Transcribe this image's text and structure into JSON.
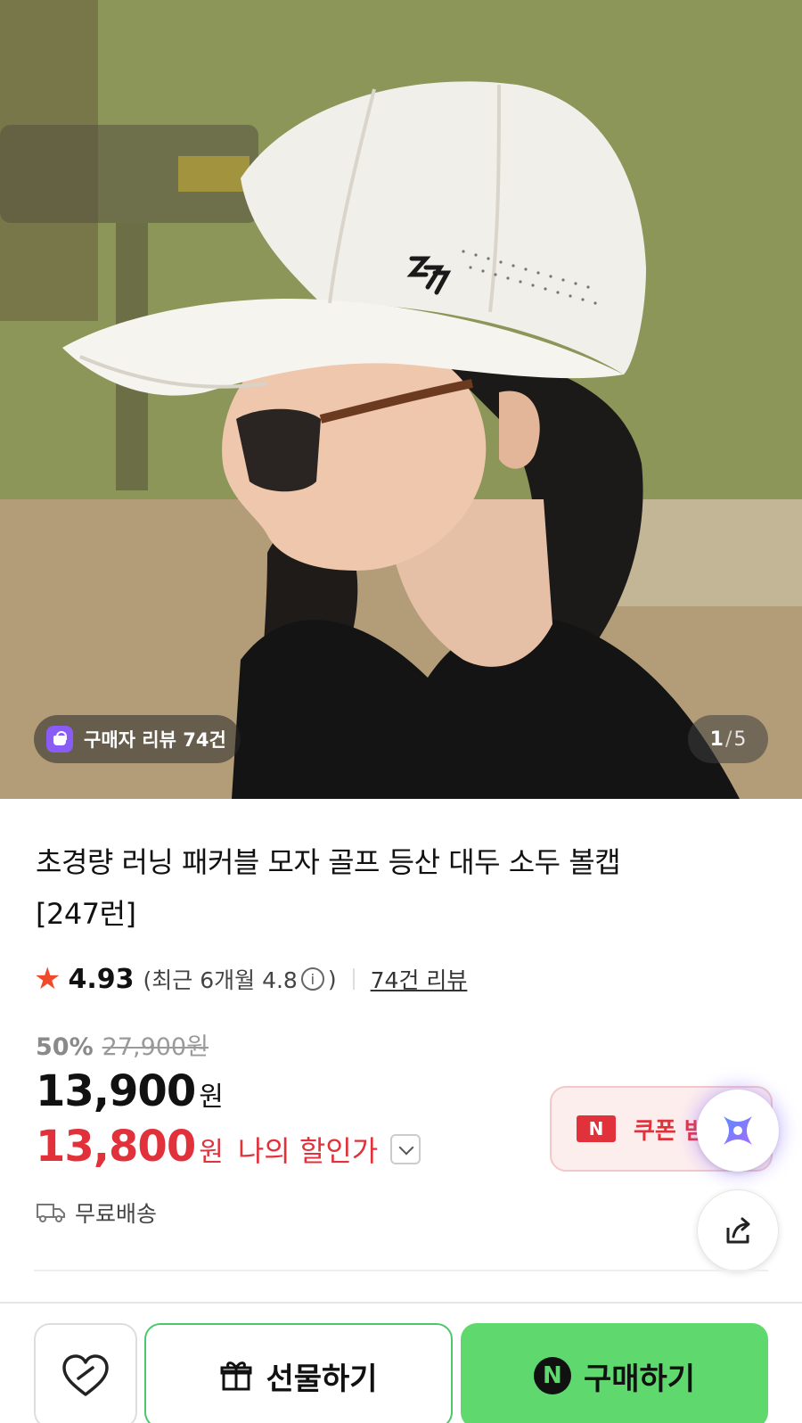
{
  "gallery": {
    "review_chip": "구매자 리뷰 74건",
    "counter_current": "1",
    "counter_separator": "/",
    "counter_total": "5"
  },
  "product": {
    "title_line1": "초경량 러닝 패커블 모자 골프 등산 대두 소두 볼캡",
    "title_line2": "[247런]",
    "rating": "4.93",
    "recent_rating": "(최근 6개월 4.8",
    "recent_rating_close": ")",
    "info_glyph": "i",
    "review_link": "74건 리뷰",
    "discount_percent": "50%",
    "original_price": "27,900원",
    "price": "13,900",
    "price_unit": "원",
    "my_price": "13,800",
    "my_price_unit": "원",
    "my_price_label": "나의 할인가",
    "shipping": "무료배송"
  },
  "coupon": {
    "badge": "N",
    "label": "쿠폰 받"
  },
  "bottom_bar": {
    "gift_label": "선물하기",
    "buy_badge": "N",
    "buy_label": "구매하기"
  },
  "colors": {
    "accent_red": "#e1323c",
    "buy_green": "#5fd96e",
    "star": "#f04a2a"
  },
  "icons": [
    "store-bag-icon",
    "star-icon",
    "info-icon",
    "chevron-down-icon",
    "truck-icon",
    "ai-sparkle-icon",
    "share-icon",
    "heart-outline-icon",
    "gift-icon",
    "naver-n-icon"
  ]
}
